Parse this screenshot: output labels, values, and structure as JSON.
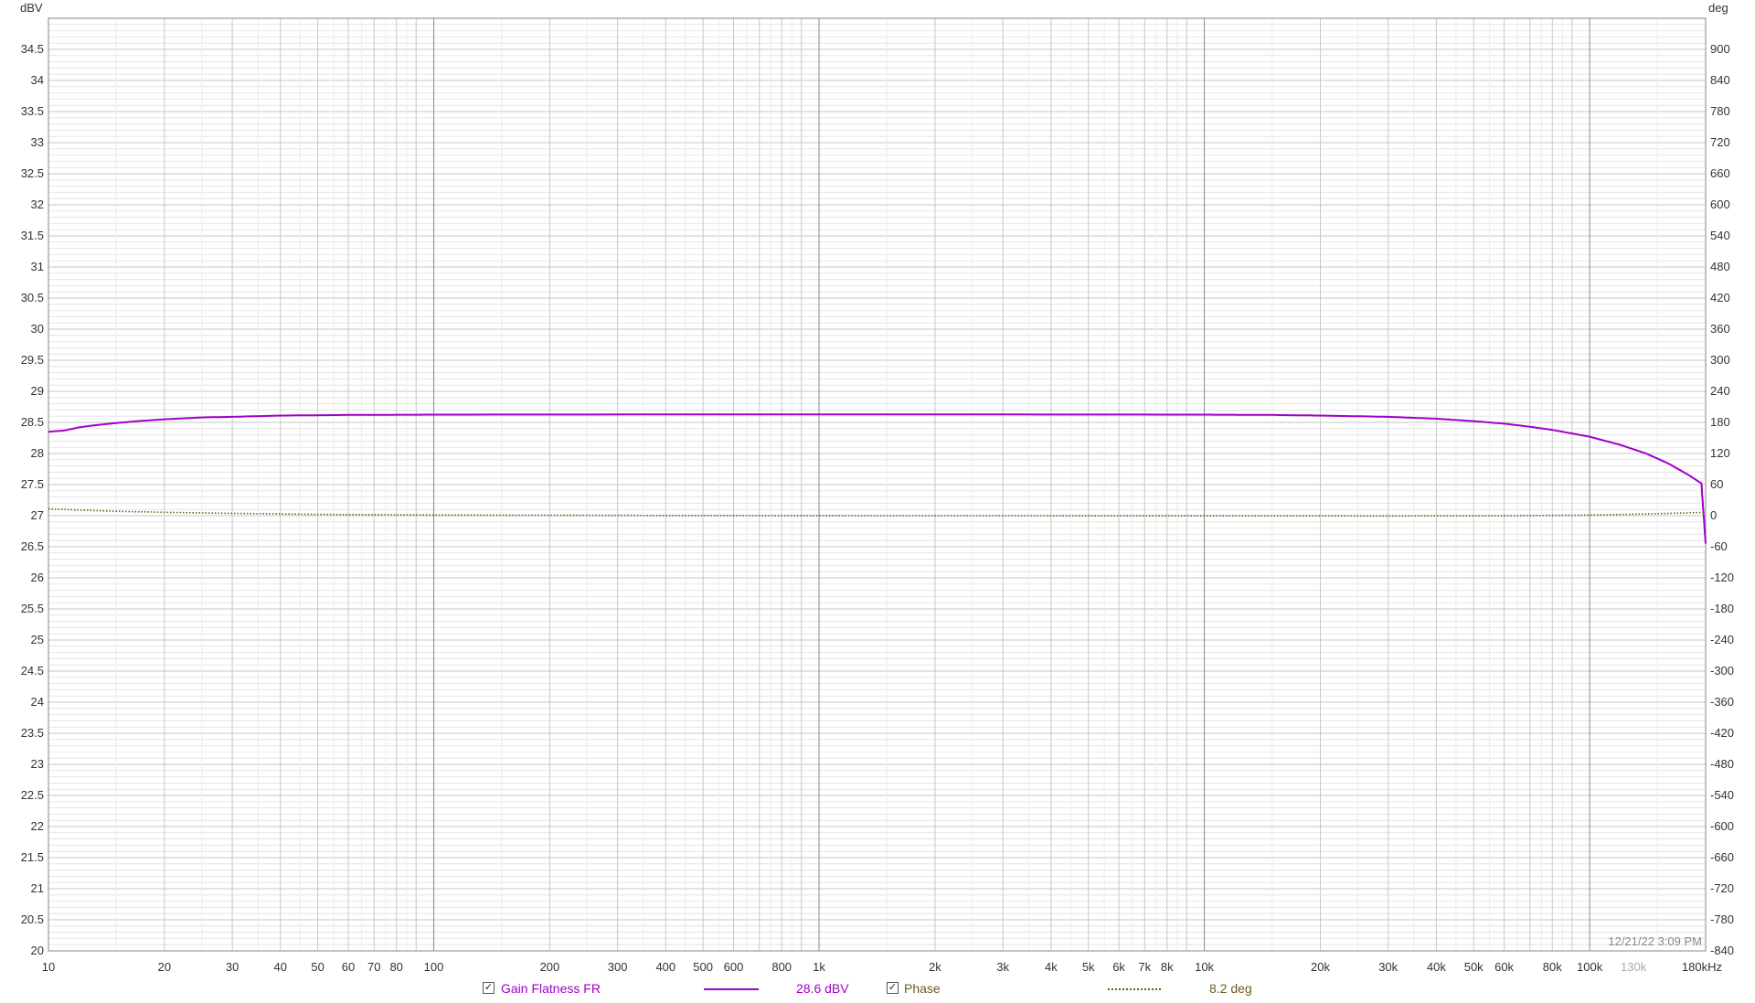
{
  "chart_data": {
    "type": "line",
    "left_axis": {
      "unit": "dBV",
      "min": 20,
      "max": 35,
      "ticks": [
        20,
        20.5,
        21,
        21.5,
        22,
        22.5,
        23,
        23.5,
        24,
        24.5,
        25,
        25.5,
        26,
        26.5,
        27,
        27.5,
        28,
        28.5,
        29,
        29.5,
        30,
        30.5,
        31,
        31.5,
        32,
        32.5,
        33,
        33.5,
        34,
        34.5
      ]
    },
    "right_axis": {
      "unit": "deg",
      "min": -840,
      "max": 960,
      "ticks": [
        -840,
        -780,
        -720,
        -660,
        -600,
        -540,
        -480,
        -420,
        -360,
        -300,
        -240,
        -180,
        -120,
        -60,
        0,
        60,
        120,
        180,
        240,
        300,
        360,
        420,
        480,
        540,
        600,
        660,
        720,
        780,
        840,
        900
      ]
    },
    "x_axis": {
      "scale": "log",
      "min": 10,
      "max": 200000,
      "unit": "kHz",
      "tick_labels": [
        {
          "v": 10,
          "t": "10"
        },
        {
          "v": 20,
          "t": "20"
        },
        {
          "v": 30,
          "t": "30"
        },
        {
          "v": 40,
          "t": "40"
        },
        {
          "v": 50,
          "t": "50"
        },
        {
          "v": 60,
          "t": "60"
        },
        {
          "v": 70,
          "t": "70"
        },
        {
          "v": 80,
          "t": "80"
        },
        {
          "v": 100,
          "t": "100"
        },
        {
          "v": 200,
          "t": "200"
        },
        {
          "v": 300,
          "t": "300"
        },
        {
          "v": 400,
          "t": "400"
        },
        {
          "v": 500,
          "t": "500"
        },
        {
          "v": 600,
          "t": "600"
        },
        {
          "v": 800,
          "t": "800"
        },
        {
          "v": 1000,
          "t": "1k"
        },
        {
          "v": 2000,
          "t": "2k"
        },
        {
          "v": 3000,
          "t": "3k"
        },
        {
          "v": 4000,
          "t": "4k"
        },
        {
          "v": 5000,
          "t": "5k"
        },
        {
          "v": 6000,
          "t": "6k"
        },
        {
          "v": 7000,
          "t": "7k"
        },
        {
          "v": 8000,
          "t": "8k"
        },
        {
          "v": 10000,
          "t": "10k"
        },
        {
          "v": 20000,
          "t": "20k"
        },
        {
          "v": 30000,
          "t": "30k"
        },
        {
          "v": 40000,
          "t": "40k"
        },
        {
          "v": 50000,
          "t": "50k"
        },
        {
          "v": 60000,
          "t": "60k"
        },
        {
          "v": 80000,
          "t": "80k"
        },
        {
          "v": 100000,
          "t": "100k"
        },
        {
          "v": 130000,
          "t": "130k",
          "muted": true
        },
        {
          "v": 180000,
          "t": "180kHz"
        }
      ]
    },
    "grid": true,
    "timestamp": "12/21/22 3:09 PM",
    "series": [
      {
        "name": "Gain Flatness FR",
        "axis": "left",
        "color": "#a000c8",
        "style": "solid",
        "readout": "28.6 dBV",
        "points": [
          [
            10,
            28.35
          ],
          [
            11,
            28.37
          ],
          [
            12,
            28.42
          ],
          [
            13,
            28.45
          ],
          [
            15,
            28.49
          ],
          [
            17,
            28.52
          ],
          [
            20,
            28.55
          ],
          [
            25,
            28.58
          ],
          [
            30,
            28.59
          ],
          [
            40,
            28.61
          ],
          [
            60,
            28.62
          ],
          [
            100,
            28.625
          ],
          [
            1000,
            28.63
          ],
          [
            10000,
            28.625
          ],
          [
            15000,
            28.62
          ],
          [
            20000,
            28.61
          ],
          [
            30000,
            28.59
          ],
          [
            40000,
            28.56
          ],
          [
            50000,
            28.52
          ],
          [
            60000,
            28.48
          ],
          [
            70000,
            28.43
          ],
          [
            80000,
            28.38
          ],
          [
            100000,
            28.27
          ],
          [
            120000,
            28.14
          ],
          [
            140000,
            28.0
          ],
          [
            160000,
            27.84
          ],
          [
            180000,
            27.66
          ],
          [
            195000,
            27.52
          ],
          [
            200000,
            26.55
          ]
        ]
      },
      {
        "name": "Phase",
        "axis": "right",
        "color": "#6e5a1e",
        "style": "dotted",
        "readout": "8.2 deg",
        "points": [
          [
            10,
            13
          ],
          [
            12,
            11
          ],
          [
            15,
            8.5
          ],
          [
            20,
            6.5
          ],
          [
            30,
            4.5
          ],
          [
            50,
            2.5
          ],
          [
            100,
            1.3
          ],
          [
            300,
            0.5
          ],
          [
            1000,
            0.1
          ],
          [
            10000,
            -0.2
          ],
          [
            30000,
            -0.5
          ],
          [
            60000,
            -0.2
          ],
          [
            100000,
            1.2
          ],
          [
            150000,
            3.8
          ],
          [
            200000,
            6.5
          ]
        ]
      }
    ]
  },
  "legend": [
    {
      "label": "Gain Flatness FR",
      "checked": "✓",
      "readout": "28.6 dBV",
      "color": "#a000c8"
    },
    {
      "label": "Phase",
      "checked": "✓",
      "readout": "8.2 deg",
      "color": "#6e5a1e"
    }
  ]
}
